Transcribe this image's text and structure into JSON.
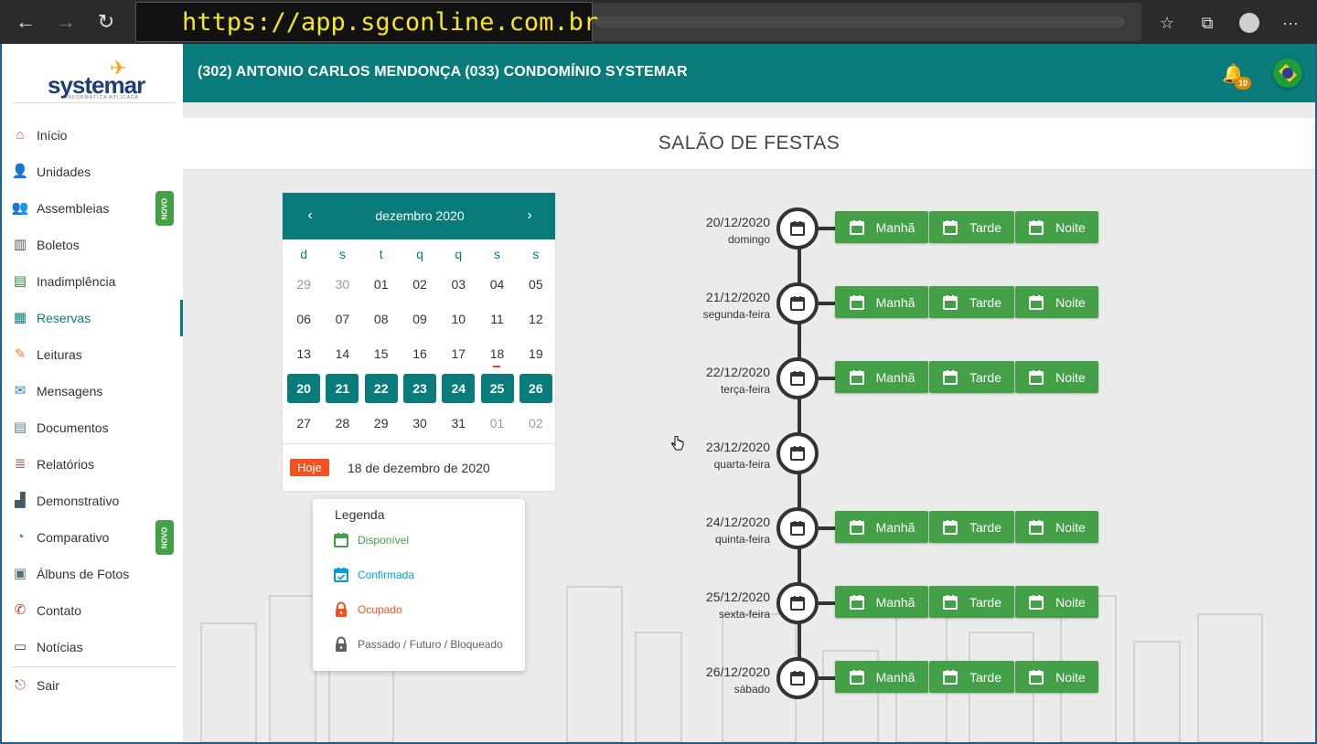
{
  "browser": {
    "url": "https://app.sgconline.com.br",
    "icons": [
      "back-arrow-icon",
      "forward-arrow-icon",
      "refresh-icon",
      "favorites-icon",
      "collections-icon",
      "profile-icon",
      "more-icon"
    ]
  },
  "logo": {
    "name": "systemar",
    "tagline": "INFORMÁTICA APLICADA"
  },
  "sidebar": {
    "items": [
      {
        "label": "Início",
        "icon": "home-icon"
      },
      {
        "label": "Unidades",
        "icon": "person-icon"
      },
      {
        "label": "Assembleias",
        "icon": "group-icon",
        "badge": "NOVO"
      },
      {
        "label": "Boletos",
        "icon": "barcode-icon"
      },
      {
        "label": "Inadimplência",
        "icon": "debt-icon"
      },
      {
        "label": "Reservas",
        "icon": "calendar-icon",
        "active": true
      },
      {
        "label": "Leituras",
        "icon": "readings-icon"
      },
      {
        "label": "Mensagens",
        "icon": "messages-icon"
      },
      {
        "label": "Documentos",
        "icon": "documents-icon"
      },
      {
        "label": "Relatórios",
        "icon": "reports-icon"
      },
      {
        "label": "Demonstrativo",
        "icon": "chart-icon"
      },
      {
        "label": "Comparativo",
        "icon": "compare-icon",
        "badge": "NOVO"
      },
      {
        "label": "Álbuns de Fotos",
        "icon": "photo-album-icon"
      },
      {
        "label": "Contato",
        "icon": "phone-icon"
      },
      {
        "label": "Notícias",
        "icon": "news-icon"
      }
    ],
    "logout": {
      "label": "Sair",
      "icon": "logout-icon"
    }
  },
  "header": {
    "title": "(302) ANTONIO CARLOS MENDONÇA  (033) CONDOMÍNIO SYSTEMAR",
    "notifications": "10"
  },
  "page": {
    "title": "SALÃO DE FESTAS"
  },
  "calendar": {
    "month": "dezembro 2020",
    "dow": [
      "d",
      "s",
      "t",
      "q",
      "q",
      "s",
      "s"
    ],
    "weeks": [
      [
        {
          "d": "29",
          "m": 1
        },
        {
          "d": "30",
          "m": 1
        },
        {
          "d": "01"
        },
        {
          "d": "02"
        },
        {
          "d": "03"
        },
        {
          "d": "04"
        },
        {
          "d": "05"
        }
      ],
      [
        {
          "d": "06"
        },
        {
          "d": "07"
        },
        {
          "d": "08"
        },
        {
          "d": "09"
        },
        {
          "d": "10"
        },
        {
          "d": "11"
        },
        {
          "d": "12"
        }
      ],
      [
        {
          "d": "13"
        },
        {
          "d": "14"
        },
        {
          "d": "15"
        },
        {
          "d": "16"
        },
        {
          "d": "17"
        },
        {
          "d": "18",
          "t": 1
        },
        {
          "d": "19"
        }
      ],
      [
        {
          "d": "20",
          "s": 1
        },
        {
          "d": "21",
          "s": 1
        },
        {
          "d": "22",
          "s": 1
        },
        {
          "d": "23",
          "s": 1
        },
        {
          "d": "24",
          "s": 1
        },
        {
          "d": "25",
          "s": 1
        },
        {
          "d": "26",
          "s": 1
        }
      ],
      [
        {
          "d": "27"
        },
        {
          "d": "28"
        },
        {
          "d": "29"
        },
        {
          "d": "30"
        },
        {
          "d": "31"
        },
        {
          "d": "01",
          "m": 1
        },
        {
          "d": "02",
          "m": 1
        }
      ]
    ],
    "today_label": "Hoje",
    "today_text": "18 de dezembro de 2020"
  },
  "legend": {
    "title": "Legenda",
    "items": [
      {
        "label": "Disponível",
        "color": "#43a047",
        "icon": "calendar-icon"
      },
      {
        "label": "Confirmada",
        "color": "#039be5",
        "icon": "calendar-check-icon"
      },
      {
        "label": "Ocupado",
        "color": "#f4511e",
        "icon": "lock-icon"
      },
      {
        "label": "Passado / Futuro / Bloqueado",
        "color": "#616161",
        "icon": "lock-icon"
      }
    ]
  },
  "timeline": [
    {
      "date": "20/12/2020",
      "day": "domingo",
      "shifts": [
        "Manhã",
        "Tarde",
        "Noite"
      ]
    },
    {
      "date": "21/12/2020",
      "day": "segunda-feira",
      "shifts": [
        "Manhã",
        "Tarde",
        "Noite"
      ]
    },
    {
      "date": "22/12/2020",
      "day": "terça-feira",
      "shifts": [
        "Manhã",
        "Tarde",
        "Noite"
      ]
    },
    {
      "date": "23/12/2020",
      "day": "quarta-feira",
      "shifts": []
    },
    {
      "date": "24/12/2020",
      "day": "quinta-feira",
      "shifts": [
        "Manhã",
        "Tarde",
        "Noite"
      ]
    },
    {
      "date": "25/12/2020",
      "day": "sexta-feira",
      "shifts": [
        "Manhã",
        "Tarde",
        "Noite"
      ]
    },
    {
      "date": "26/12/2020",
      "day": "sábado",
      "shifts": [
        "Manhã",
        "Tarde",
        "Noite"
      ]
    }
  ],
  "colors": {
    "primary": "#0a7b7b",
    "available": "#43a047",
    "confirmed": "#039be5",
    "occupied": "#f4511e",
    "blocked": "#616161"
  }
}
